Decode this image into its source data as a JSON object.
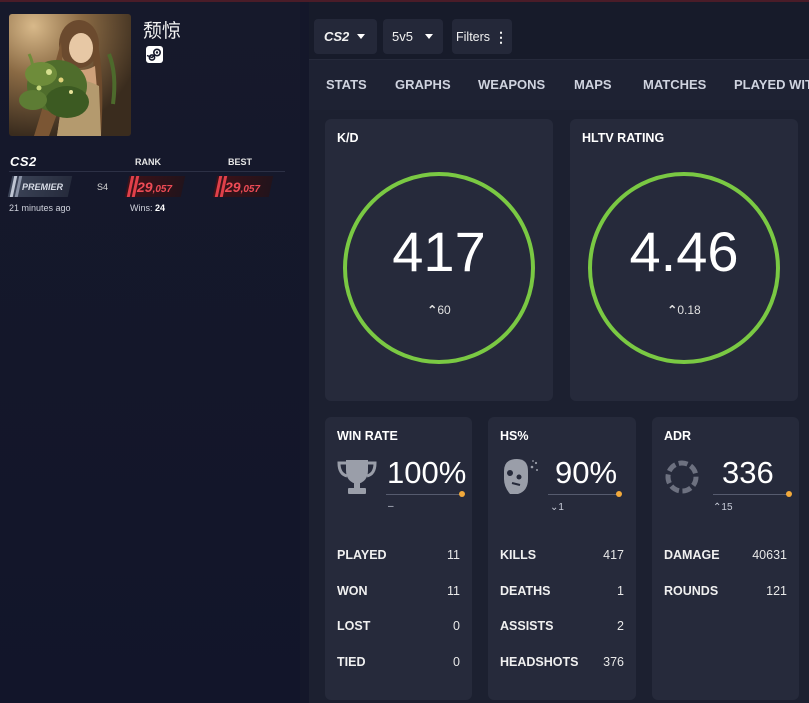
{
  "profile": {
    "username": "颓惊",
    "platform_icon": "steam-icon"
  },
  "rank": {
    "game_logo": "CS2",
    "rank_header": "RANK",
    "best_header": "BEST",
    "type": "PREMIER",
    "season": "S4",
    "rank_value_main": "29",
    "rank_value_sub": ",057",
    "best_value_main": "29",
    "best_value_sub": ",057",
    "updated": "21 minutes ago",
    "wins_label": "Wins:",
    "wins_value": "24",
    "accent_color": "#e0404a"
  },
  "filters": {
    "game": "CS2",
    "mode": "5v5",
    "filters_label": "Filters"
  },
  "tabs": [
    "STATS",
    "GRAPHS",
    "WEAPONS",
    "MAPS",
    "MATCHES",
    "PLAYED WIT"
  ],
  "kd": {
    "title": "K/D",
    "value": "417",
    "delta": "60",
    "delta_dir": "up",
    "ring_color": "#7ac943"
  },
  "hltv": {
    "title": "HLTV RATING",
    "value": "4.46",
    "delta": "0.18",
    "delta_dir": "up",
    "ring_color": "#7ac943"
  },
  "win_rate": {
    "title": "WIN RATE",
    "icon": "trophy-icon",
    "value": "100%",
    "delta": "–",
    "rows": [
      {
        "label": "PLAYED",
        "value": "11"
      },
      {
        "label": "WON",
        "value": "11"
      },
      {
        "label": "LOST",
        "value": "0"
      },
      {
        "label": "TIED",
        "value": "0"
      }
    ]
  },
  "hs": {
    "title": "HS%",
    "icon": "headshot-icon",
    "value": "90%",
    "delta": "1",
    "delta_dir": "down",
    "rows": [
      {
        "label": "KILLS",
        "value": "417"
      },
      {
        "label": "DEATHS",
        "value": "1"
      },
      {
        "label": "ASSISTS",
        "value": "2"
      },
      {
        "label": "HEADSHOTS",
        "value": "376"
      }
    ]
  },
  "adr": {
    "title": "ADR",
    "icon": "adr-ring-icon",
    "value": "336",
    "delta": "15",
    "delta_dir": "up",
    "rows": [
      {
        "label": "DAMAGE",
        "value": "40631"
      },
      {
        "label": "ROUNDS",
        "value": "121"
      }
    ]
  },
  "colors": {
    "background": "#14172a",
    "card": "#262a3b",
    "progress_dot": "#f2a93b"
  }
}
